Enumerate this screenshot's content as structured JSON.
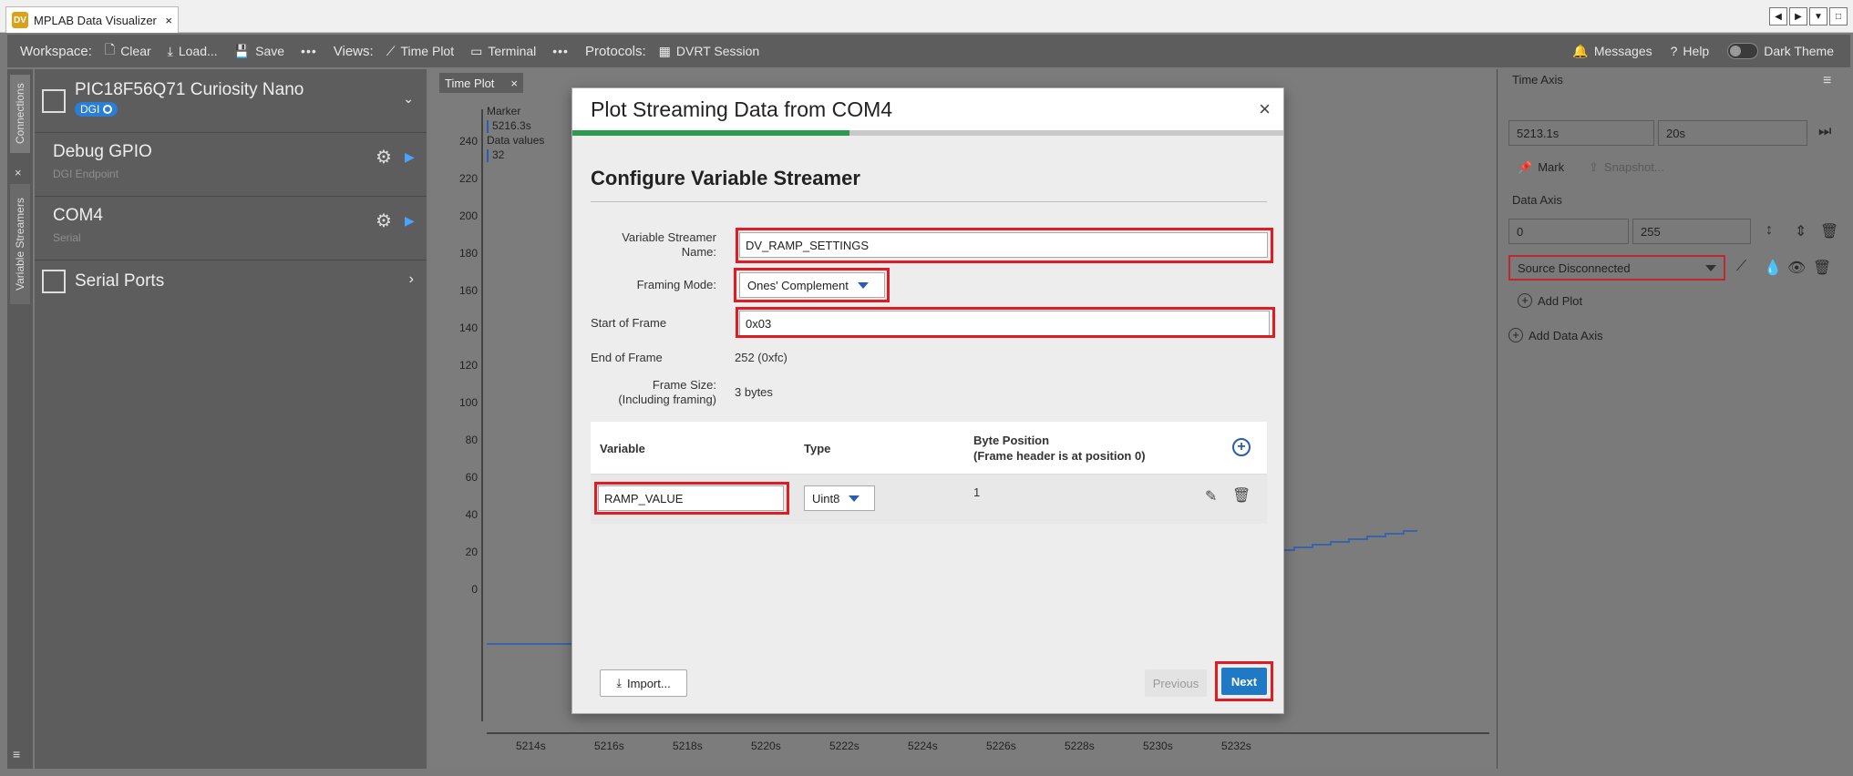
{
  "app": {
    "tab_title": "MPLAB Data Visualizer",
    "tab_close": "×",
    "logo_text": "DV"
  },
  "toolbar": {
    "workspace_label": "Workspace:",
    "clear_label": "Clear",
    "load_label": "Load...",
    "save_label": "Save",
    "more1": "•••",
    "views_label": "Views:",
    "timeplot_label": "Time Plot",
    "terminal_label": "Terminal",
    "more2": "•••",
    "protocols_label": "Protocols:",
    "dvrt_label": "DVRT Session",
    "messages_label": "Messages",
    "help_label": "Help",
    "darktheme_label": "Dark Theme"
  },
  "sidetabs": {
    "connections": "Connections",
    "variable_streamers": "Variable Streamers",
    "close": "×"
  },
  "left_panel": {
    "device_title": "PIC18F56Q71 Curiosity Nano",
    "dgi_badge": "DGI",
    "debug_gpio": {
      "title": "Debug GPIO",
      "sub": "DGI Endpoint"
    },
    "com4": {
      "title": "COM4",
      "sub": "Serial"
    },
    "serial_ports": "Serial Ports"
  },
  "plot": {
    "tab_label": "Time Plot",
    "tab_close": "×",
    "marker_label": "Marker",
    "marker_value": "5216.3s",
    "data_values_label": "Data values",
    "data_value": "32",
    "y_ticks": [
      "240",
      "220",
      "200",
      "180",
      "160",
      "140",
      "120",
      "100",
      "80",
      "60",
      "40",
      "20",
      "0"
    ],
    "x_ticks": [
      "5214s",
      "5216s",
      "5218s",
      "5220s",
      "5222s",
      "5224s",
      "5226s",
      "5228s",
      "5230s",
      "5232s"
    ]
  },
  "right_panel": {
    "time_axis_label": "Time Axis",
    "time_start": "5213.1s",
    "time_span": "20s",
    "mark_label": "Mark",
    "snapshot_label": "Snapshot...",
    "data_axis_label": "Data Axis",
    "data_min": "0",
    "data_max": "255",
    "source_select": "Source Disconnected",
    "add_plot_label": "Add Plot",
    "add_data_axis_label": "Add Data Axis"
  },
  "modal": {
    "title": "Plot Streaming Data from COM4",
    "close": "×",
    "progress_fraction": 0.39,
    "section_title": "Configure Variable Streamer",
    "streamer_name_label": "Variable Streamer Name:",
    "streamer_name_value": "DV_RAMP_SETTINGS",
    "framing_mode_label": "Framing Mode:",
    "framing_mode_value": "Ones' Complement",
    "start_of_frame_label": "Start of Frame",
    "start_of_frame_value": "0x03",
    "end_of_frame_label": "End of Frame",
    "end_of_frame_value": "252 (0xfc)",
    "frame_size_label_1": "Frame Size:",
    "frame_size_label_2": "(Including framing)",
    "frame_size_value": "3 bytes",
    "table": {
      "col_variable": "Variable",
      "col_type": "Type",
      "col_byte_position_1": "Byte Position",
      "col_byte_position_2": "(Frame header is at position 0)",
      "rows": [
        {
          "variable": "RAMP_VALUE",
          "type": "Uint8",
          "byte_position": "1"
        }
      ]
    },
    "import_label": "Import...",
    "previous_label": "Previous",
    "next_label": "Next"
  },
  "colors": {
    "highlight": "#e01b24",
    "accent": "#2a7fd4",
    "progress": "#2a9b4f"
  }
}
